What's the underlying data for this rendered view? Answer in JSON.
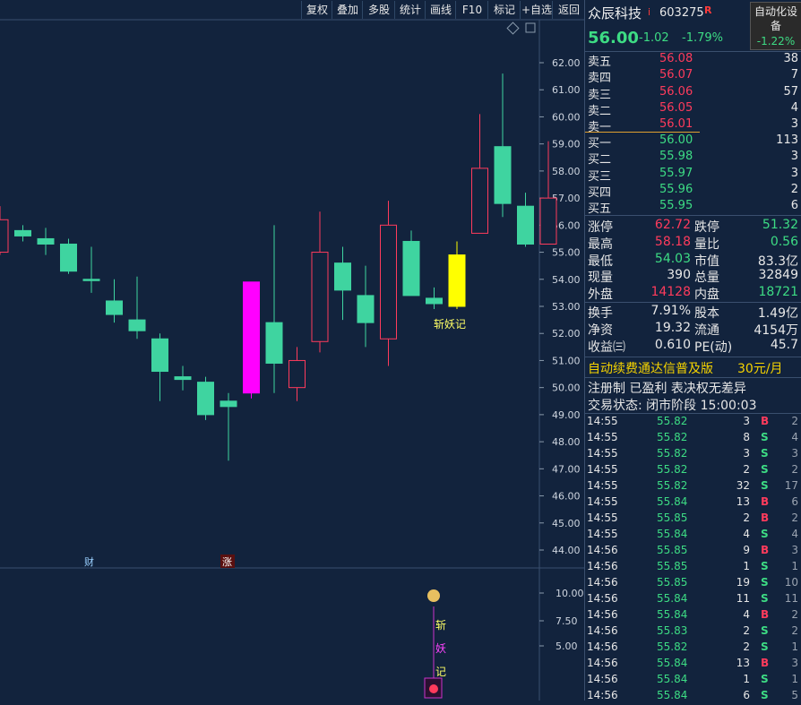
{
  "toolbar": {
    "buttons": [
      "复权",
      "叠加",
      "多股",
      "统计",
      "画线",
      "F10",
      "标记",
      "+自选",
      "返回"
    ]
  },
  "chart_data": {
    "type": "candlestick",
    "y_ticks": [
      "62.00",
      "61.00",
      "60.00",
      "59.00",
      "58.00",
      "57.00",
      "56.00",
      "55.00",
      "54.00",
      "53.00",
      "52.00",
      "51.00",
      "50.00",
      "49.00",
      "48.00",
      "47.00",
      "46.00",
      "45.00",
      "44.00"
    ],
    "sub_ticks": [
      "10.00",
      "7.50",
      "5.00"
    ],
    "ylim": [
      43.6,
      62.3
    ],
    "candles": [
      {
        "o": 56.2,
        "h": 56.7,
        "l": 54.9,
        "c": 55.0,
        "color": "up"
      },
      {
        "o": 55.8,
        "h": 56.0,
        "l": 55.4,
        "c": 55.6,
        "color": "down"
      },
      {
        "o": 55.5,
        "h": 55.9,
        "l": 54.9,
        "c": 55.3,
        "color": "down"
      },
      {
        "o": 55.3,
        "h": 55.5,
        "l": 54.2,
        "c": 54.3,
        "color": "down"
      },
      {
        "o": 54.0,
        "h": 55.2,
        "l": 53.5,
        "c": 54.0,
        "color": "down"
      },
      {
        "o": 53.2,
        "h": 54.0,
        "l": 52.4,
        "c": 52.7,
        "color": "down"
      },
      {
        "o": 52.5,
        "h": 54.1,
        "l": 51.8,
        "c": 52.1,
        "color": "down"
      },
      {
        "o": 51.8,
        "h": 52.0,
        "l": 49.5,
        "c": 50.6,
        "color": "down"
      },
      {
        "o": 50.4,
        "h": 50.8,
        "l": 49.9,
        "c": 50.3,
        "color": "down"
      },
      {
        "o": 50.2,
        "h": 50.4,
        "l": 48.8,
        "c": 49.0,
        "color": "down"
      },
      {
        "o": 49.5,
        "h": 49.8,
        "l": 47.3,
        "c": 49.3,
        "color": "down"
      },
      {
        "o": 49.8,
        "h": 53.9,
        "l": 49.6,
        "c": 53.9,
        "color": "magenta"
      },
      {
        "o": 52.4,
        "h": 56.0,
        "l": 49.8,
        "c": 50.9,
        "color": "down"
      },
      {
        "o": 50.0,
        "h": 51.5,
        "l": 49.5,
        "c": 51.0,
        "color": "up"
      },
      {
        "o": 51.7,
        "h": 56.5,
        "l": 51.3,
        "c": 55.0,
        "color": "up"
      },
      {
        "o": 54.6,
        "h": 55.2,
        "l": 52.5,
        "c": 53.6,
        "color": "down"
      },
      {
        "o": 53.4,
        "h": 54.5,
        "l": 51.5,
        "c": 52.4,
        "color": "down"
      },
      {
        "o": 51.8,
        "h": 56.9,
        "l": 50.8,
        "c": 56.0,
        "color": "up"
      },
      {
        "o": 55.4,
        "h": 55.8,
        "l": 53.4,
        "c": 53.4,
        "color": "down"
      },
      {
        "o": 53.3,
        "h": 53.7,
        "l": 52.9,
        "c": 53.1,
        "color": "down"
      },
      {
        "o": 53.0,
        "h": 55.4,
        "l": 52.9,
        "c": 54.9,
        "color": "yellow"
      },
      {
        "o": 55.7,
        "h": 60.1,
        "l": 55.7,
        "c": 58.1,
        "color": "up"
      },
      {
        "o": 58.9,
        "h": 61.6,
        "l": 56.3,
        "c": 56.8,
        "color": "down"
      },
      {
        "o": 56.7,
        "h": 57.2,
        "l": 55.2,
        "c": 55.3,
        "color": "down"
      },
      {
        "o": 55.3,
        "h": 59.1,
        "l": 55.3,
        "c": 57.0,
        "color": "up"
      }
    ],
    "annotation": "斩妖记",
    "markers": [
      "财",
      "涨"
    ],
    "sub_annotation": [
      "斩",
      "妖",
      "记"
    ]
  },
  "header": {
    "name": "众辰科技",
    "flag": "i",
    "code": "603275",
    "r": "R",
    "price": "56.00",
    "change": "-1.02",
    "change_pct": "-1.79%",
    "auto_label": "自动化设备",
    "auto_pct": "-1.22%"
  },
  "asks": [
    {
      "label": "卖五",
      "price": "56.08",
      "vol": "38"
    },
    {
      "label": "卖四",
      "price": "56.07",
      "vol": "7"
    },
    {
      "label": "卖三",
      "price": "56.06",
      "vol": "57"
    },
    {
      "label": "卖二",
      "price": "56.05",
      "vol": "4"
    },
    {
      "label": "卖一",
      "price": "56.01",
      "vol": "3"
    }
  ],
  "bids": [
    {
      "label": "买一",
      "price": "56.00",
      "vol": "113"
    },
    {
      "label": "买二",
      "price": "55.98",
      "vol": "3"
    },
    {
      "label": "买三",
      "price": "55.97",
      "vol": "3"
    },
    {
      "label": "买四",
      "price": "55.96",
      "vol": "2"
    },
    {
      "label": "买五",
      "price": "55.95",
      "vol": "6"
    }
  ],
  "stats": [
    {
      "l1": "涨停",
      "v1": "62.72",
      "c1": "red",
      "l2": "跌停",
      "v2": "51.32",
      "c2": "green"
    },
    {
      "l1": "最高",
      "v1": "58.18",
      "c1": "red",
      "l2": "量比",
      "v2": "0.56",
      "c2": "green"
    },
    {
      "l1": "最低",
      "v1": "54.03",
      "c1": "green",
      "l2": "市值",
      "v2": "83.3亿",
      "c2": "white"
    },
    {
      "l1": "现量",
      "v1": "390",
      "c1": "white",
      "l2": "总量",
      "v2": "32849",
      "c2": "white"
    },
    {
      "l1": "外盘",
      "v1": "14128",
      "c1": "red",
      "l2": "内盘",
      "v2": "18721",
      "c2": "green"
    }
  ],
  "stats2": [
    {
      "l1": "换手",
      "v1": "7.91%",
      "l2": "股本",
      "v2": "1.49亿"
    },
    {
      "l1": "净资",
      "v1": "19.32",
      "l2": "流通",
      "v2": "4154万"
    },
    {
      "l1": "收益㈢",
      "v1": "0.610",
      "l2": "PE(动)",
      "v2": "45.7"
    }
  ],
  "promo": {
    "text": "自动续费通达信普及版",
    "price": "30元/月"
  },
  "reg_text": "注册制 已盈利 表决权无差异",
  "status_text": "交易状态: 闭市阶段 15:00:03",
  "trades": [
    {
      "t": "14:55",
      "p": "55.82",
      "v": "3",
      "bs": "B",
      "n": "2"
    },
    {
      "t": "14:55",
      "p": "55.82",
      "v": "8",
      "bs": "S",
      "n": "4"
    },
    {
      "t": "14:55",
      "p": "55.82",
      "v": "3",
      "bs": "S",
      "n": "3"
    },
    {
      "t": "14:55",
      "p": "55.82",
      "v": "2",
      "bs": "S",
      "n": "2"
    },
    {
      "t": "14:55",
      "p": "55.82",
      "v": "32",
      "bs": "S",
      "n": "17"
    },
    {
      "t": "14:55",
      "p": "55.84",
      "v": "13",
      "bs": "B",
      "n": "6"
    },
    {
      "t": "14:55",
      "p": "55.85",
      "v": "2",
      "bs": "B",
      "n": "2"
    },
    {
      "t": "14:55",
      "p": "55.84",
      "v": "4",
      "bs": "S",
      "n": "4"
    },
    {
      "t": "14:56",
      "p": "55.85",
      "v": "9",
      "bs": "B",
      "n": "3"
    },
    {
      "t": "14:56",
      "p": "55.85",
      "v": "1",
      "bs": "S",
      "n": "1"
    },
    {
      "t": "14:56",
      "p": "55.85",
      "v": "19",
      "bs": "S",
      "n": "10"
    },
    {
      "t": "14:56",
      "p": "55.84",
      "v": "11",
      "bs": "S",
      "n": "11"
    },
    {
      "t": "14:56",
      "p": "55.84",
      "v": "4",
      "bs": "B",
      "n": "2"
    },
    {
      "t": "14:56",
      "p": "55.83",
      "v": "2",
      "bs": "S",
      "n": "2"
    },
    {
      "t": "14:56",
      "p": "55.82",
      "v": "2",
      "bs": "S",
      "n": "1"
    },
    {
      "t": "14:56",
      "p": "55.84",
      "v": "13",
      "bs": "B",
      "n": "3"
    },
    {
      "t": "14:56",
      "p": "55.84",
      "v": "1",
      "bs": "S",
      "n": "1"
    },
    {
      "t": "14:56",
      "p": "55.84",
      "v": "6",
      "bs": "S",
      "n": "5"
    }
  ]
}
